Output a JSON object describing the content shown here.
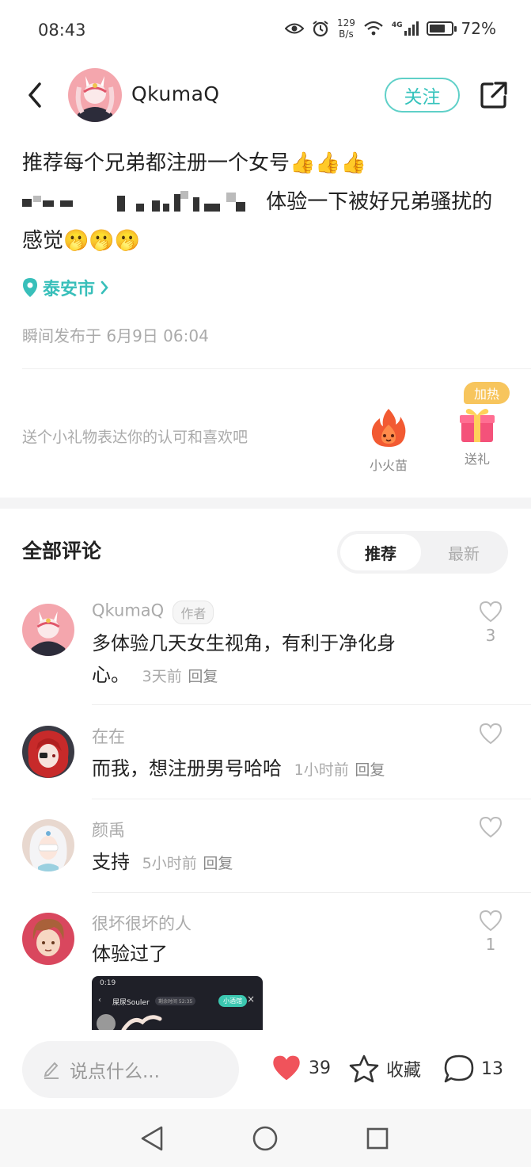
{
  "status_bar": {
    "time": "08:43",
    "net_speed_value": "129",
    "net_speed_unit": "B/s",
    "signal_label": "4G",
    "battery_percent": "72%",
    "battery_level": 0.72
  },
  "header": {
    "author_name": "QkumaQ",
    "follow_label": "关注"
  },
  "post": {
    "line1": "推荐每个兄弟都注册一个女号👍👍👍",
    "line2_visible": "体验一下被好兄弟骚扰的",
    "line3": "感觉🫢🫢🫢",
    "location": "泰安市",
    "time": "瞬间发布于 6月9日 06:04"
  },
  "gift_section": {
    "prompt": "送个小礼物表达你的认可和喜欢吧",
    "fire_label": "小火苗",
    "gift_label": "送礼",
    "boost_badge": "加热"
  },
  "comments_section": {
    "title": "全部评论",
    "sort_recommended": "推荐",
    "sort_latest": "最新"
  },
  "comments": [
    {
      "name": "QkumaQ",
      "tag": "作者",
      "text_line1": "多体验几天女生视角，有利于净化身",
      "text_line2": "心。",
      "time": "3天前",
      "reply": "回复",
      "likes": "3"
    },
    {
      "name": "在在",
      "text": "而我，想注册男号哈哈",
      "time": "1小时前",
      "reply": "回复"
    },
    {
      "name": "颜禹",
      "text": "支持",
      "time": "5小时前",
      "reply": "回复"
    },
    {
      "name": "很坏很坏的人",
      "text": "体验过了",
      "likes": "1",
      "attachment": {
        "time": "0:19",
        "title": "屎尿Souler",
        "pill": "小酒馆",
        "badge": "剩余时间 52:35"
      }
    }
  ],
  "bottom_bar": {
    "input_placeholder": "说点什么...",
    "like_count": "39",
    "favorite_label": "收藏",
    "comment_count": "13"
  },
  "colors": {
    "accent_teal": "#35c3bc",
    "like_red": "#f0535b",
    "boost_badge": "#f7c55d"
  }
}
